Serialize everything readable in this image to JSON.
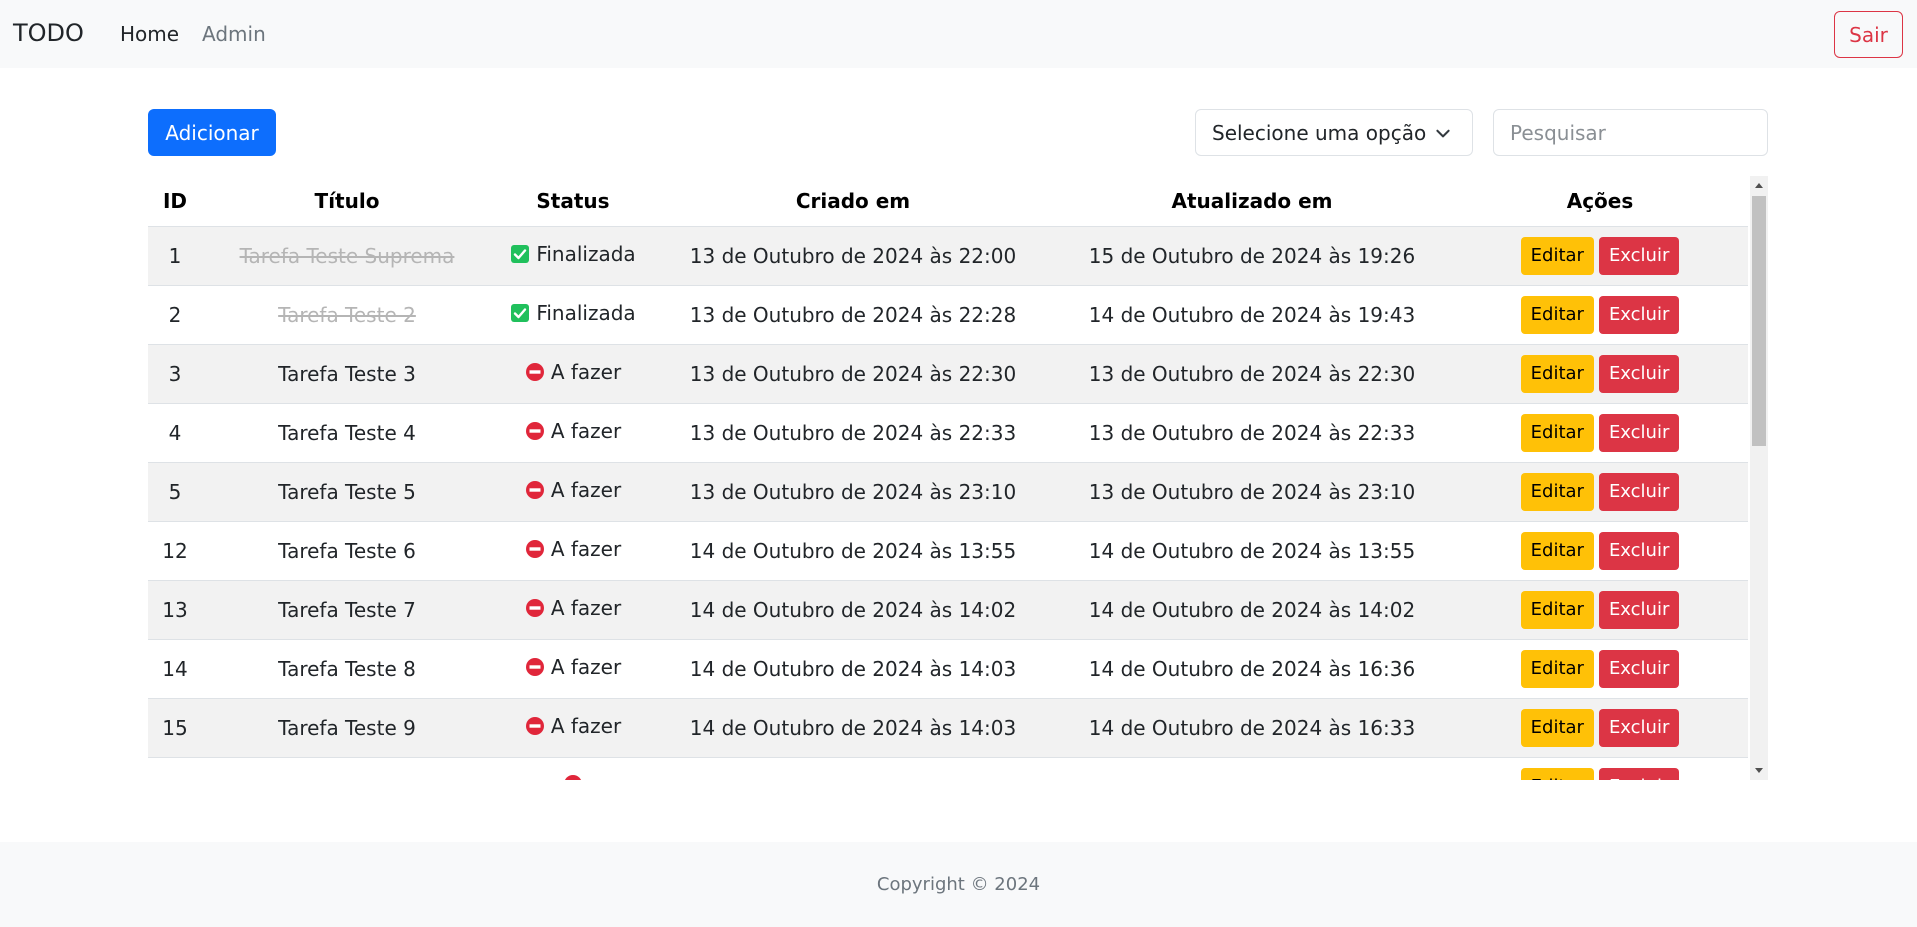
{
  "nav": {
    "brand": "TODO",
    "home": "Home",
    "admin": "Admin",
    "logout": "Sair"
  },
  "toolbar": {
    "add": "Adicionar",
    "select_value": "Selecione uma opção",
    "search_placeholder": "Pesquisar"
  },
  "table": {
    "headers": {
      "id": "ID",
      "title": "Título",
      "status": "Status",
      "created": "Criado em",
      "updated": "Atualizado em",
      "actions": "Ações"
    },
    "edit_label": "Editar",
    "delete_label": "Excluir",
    "rows": [
      {
        "id": "1",
        "title": "Tarefa Teste Suprema",
        "status": "Finalizada",
        "done": true,
        "created": "13 de Outubro de 2024 às 22:00",
        "updated": "15 de Outubro de 2024 às 19:26"
      },
      {
        "id": "2",
        "title": "Tarefa Teste 2",
        "status": "Finalizada",
        "done": true,
        "created": "13 de Outubro de 2024 às 22:28",
        "updated": "14 de Outubro de 2024 às 19:43"
      },
      {
        "id": "3",
        "title": "Tarefa Teste 3",
        "status": "A fazer",
        "done": false,
        "created": "13 de Outubro de 2024 às 22:30",
        "updated": "13 de Outubro de 2024 às 22:30"
      },
      {
        "id": "4",
        "title": "Tarefa Teste 4",
        "status": "A fazer",
        "done": false,
        "created": "13 de Outubro de 2024 às 22:33",
        "updated": "13 de Outubro de 2024 às 22:33"
      },
      {
        "id": "5",
        "title": "Tarefa Teste 5",
        "status": "A fazer",
        "done": false,
        "created": "13 de Outubro de 2024 às 23:10",
        "updated": "13 de Outubro de 2024 às 23:10"
      },
      {
        "id": "12",
        "title": "Tarefa Teste 6",
        "status": "A fazer",
        "done": false,
        "created": "14 de Outubro de 2024 às 13:55",
        "updated": "14 de Outubro de 2024 às 13:55"
      },
      {
        "id": "13",
        "title": "Tarefa Teste 7",
        "status": "A fazer",
        "done": false,
        "created": "14 de Outubro de 2024 às 14:02",
        "updated": "14 de Outubro de 2024 às 14:02"
      },
      {
        "id": "14",
        "title": "Tarefa Teste 8",
        "status": "A fazer",
        "done": false,
        "created": "14 de Outubro de 2024 às 14:03",
        "updated": "14 de Outubro de 2024 às 16:36"
      },
      {
        "id": "15",
        "title": "Tarefa Teste 9",
        "status": "A fazer",
        "done": false,
        "created": "14 de Outubro de 2024 às 14:03",
        "updated": "14 de Outubro de 2024 às 16:33"
      },
      {
        "id": "",
        "title": "",
        "status": "",
        "done": false,
        "created": "",
        "updated": ""
      }
    ]
  },
  "icons": {
    "done": "check-square-icon",
    "todo": "no-entry-icon"
  },
  "colors": {
    "primary": "#0d6efd",
    "danger": "#dc3545",
    "warning": "#ffc107",
    "success": "#20c05c"
  },
  "footer": {
    "copyright": "Copyright © 2024"
  }
}
